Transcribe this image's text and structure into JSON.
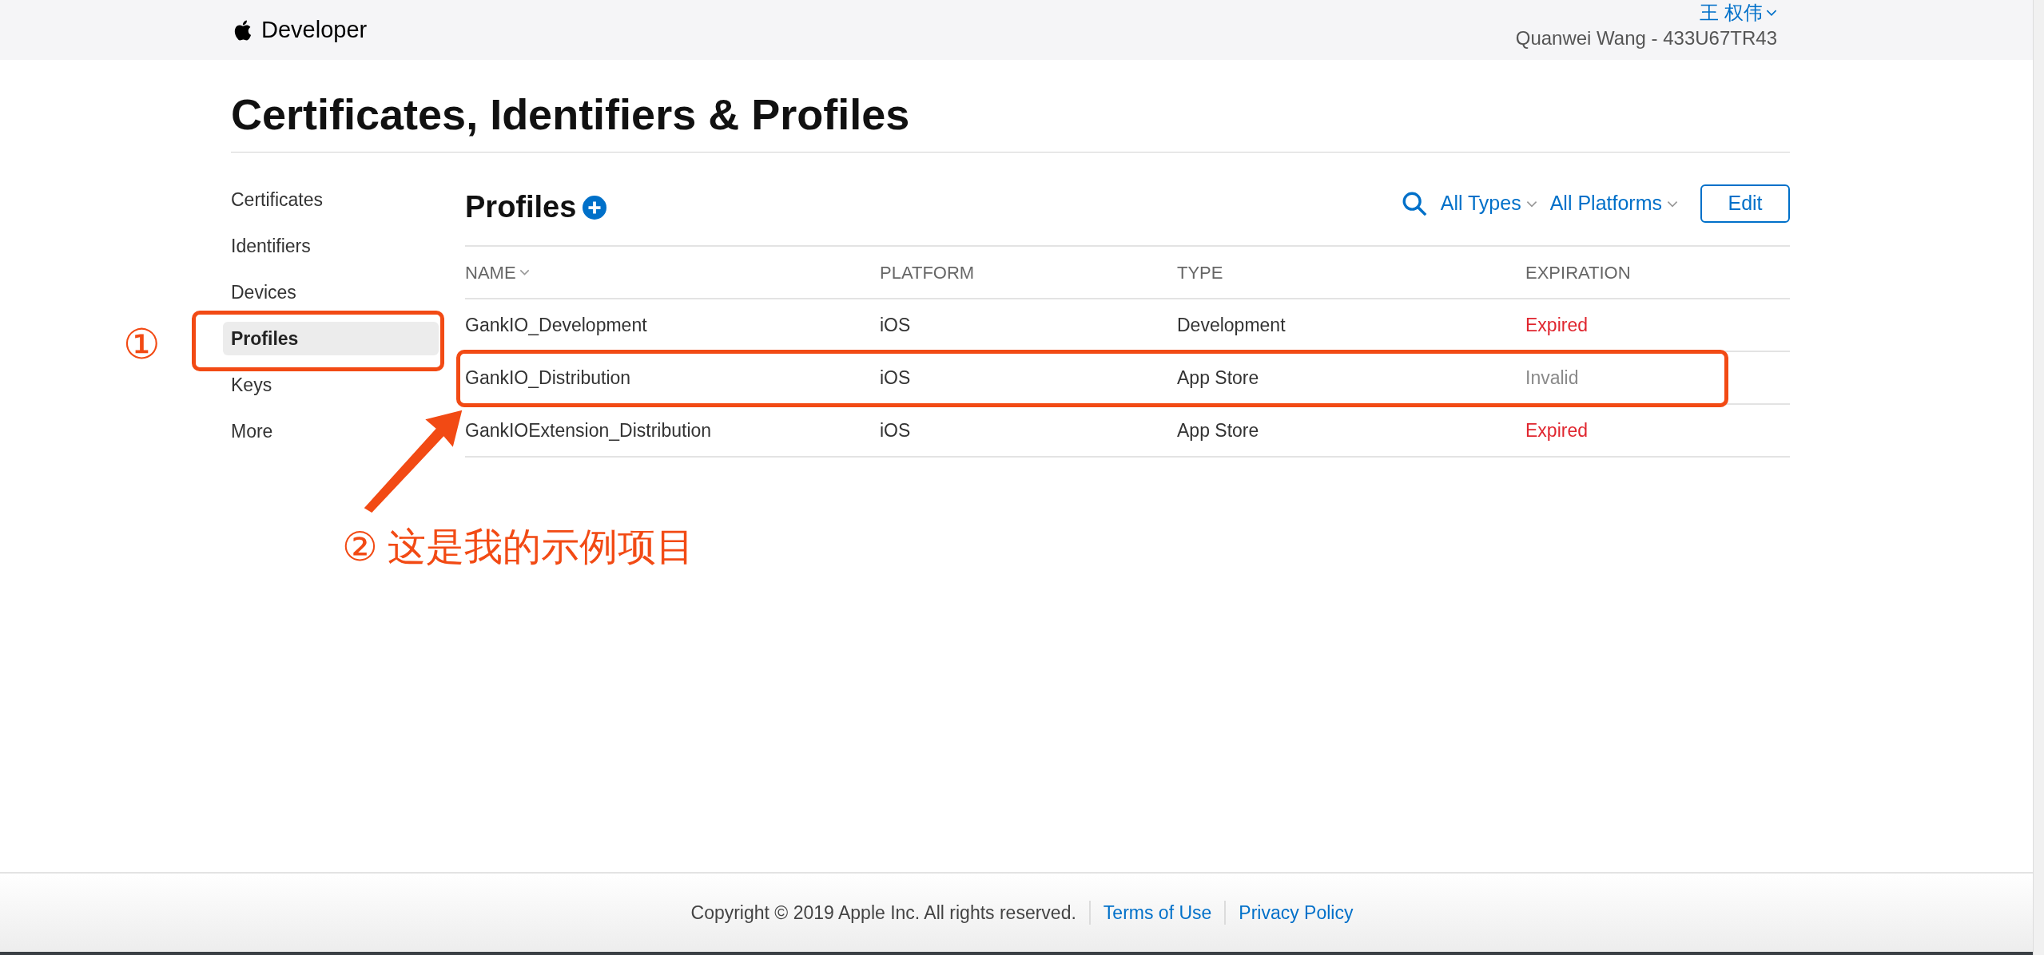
{
  "header": {
    "brand": "Developer",
    "user_name": "王 权伟",
    "account": "Quanwei Wang - 433U67TR43"
  },
  "page_title": "Certificates, Identifiers & Profiles",
  "sidebar": {
    "items": [
      {
        "label": "Certificates",
        "selected": false
      },
      {
        "label": "Identifiers",
        "selected": false
      },
      {
        "label": "Devices",
        "selected": false
      },
      {
        "label": "Profiles",
        "selected": true,
        "highlighted": true
      },
      {
        "label": "Keys",
        "selected": false
      },
      {
        "label": "More",
        "selected": false
      }
    ]
  },
  "section": {
    "title": "Profiles",
    "filters": [
      "All Types",
      "All Platforms"
    ],
    "edit_button": "Edit"
  },
  "table": {
    "columns": [
      "NAME",
      "PLATFORM",
      "TYPE",
      "EXPIRATION"
    ],
    "rows": [
      {
        "name": "GankIO_Development",
        "platform": "iOS",
        "type": "Development",
        "expiration": "Expired",
        "kind": "expired",
        "highlighted": false
      },
      {
        "name": "GankIO_Distribution",
        "platform": "iOS",
        "type": "App Store",
        "expiration": "Invalid",
        "kind": "invalid",
        "highlighted": true
      },
      {
        "name": "GankIOExtension_Distribution",
        "platform": "iOS",
        "type": "App Store",
        "expiration": "Expired",
        "kind": "expired",
        "highlighted": false
      }
    ]
  },
  "annotations": {
    "step_1": "①",
    "step_2": "②",
    "note": "这是我的示例项目"
  },
  "footer": {
    "copyright": "Copyright © 2019 Apple Inc. All rights reserved.",
    "links": [
      "Terms of Use",
      "Privacy Policy"
    ]
  }
}
